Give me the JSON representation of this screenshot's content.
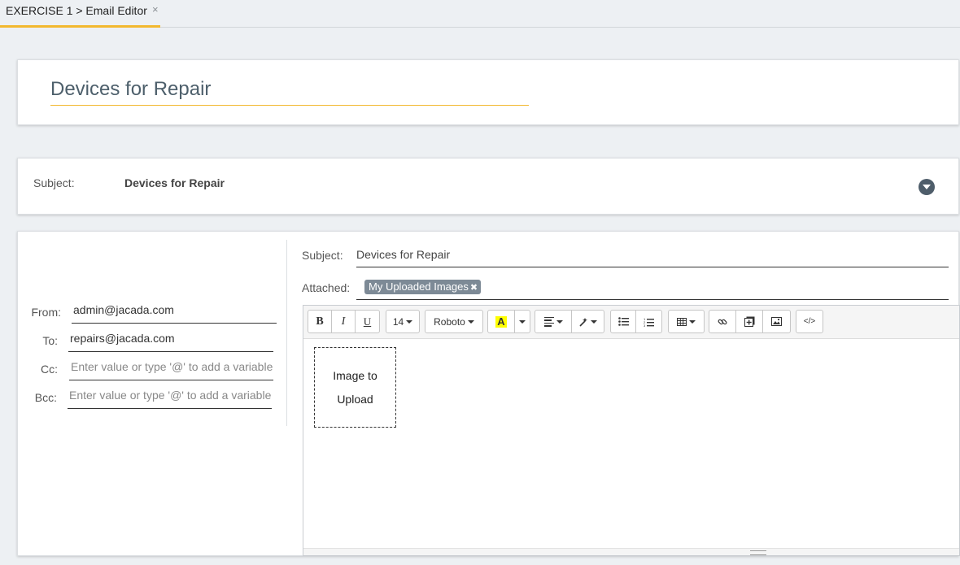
{
  "tab": {
    "label": "EXERCISE 1 > Email Editor",
    "close": "×"
  },
  "title_card": {
    "value": "Devices for Repair"
  },
  "subject_card": {
    "label": "Subject:",
    "value": "Devices for Repair"
  },
  "recipients": {
    "from_label": "From:",
    "from_value": "admin@jacada.com",
    "to_label": "To:",
    "to_value": "repairs@jacada.com",
    "cc_label": "Cc:",
    "cc_placeholder": "Enter value or type '@' to add a variable",
    "bcc_label": "Bcc:",
    "bcc_placeholder": "Enter value or type '@' to add a variable"
  },
  "compose": {
    "subject_label": "Subject:",
    "subject_value": "Devices for Repair",
    "attached_label": "Attached:",
    "attachment_chip": "My Uploaded Images",
    "chip_remove": "✖"
  },
  "toolbar": {
    "bold": "B",
    "italic": "I",
    "underline": "U",
    "font_size": "14",
    "font_name": "Roboto",
    "highlight": "A",
    "codeview": "</>"
  },
  "editor_body": {
    "image_line1": "Image to",
    "image_line2": "Upload"
  },
  "colors": {
    "accent": "#f2b82e",
    "chip": "#7d8a96",
    "highlight": "#ffff00",
    "expand_button": "#4e5d6a"
  }
}
